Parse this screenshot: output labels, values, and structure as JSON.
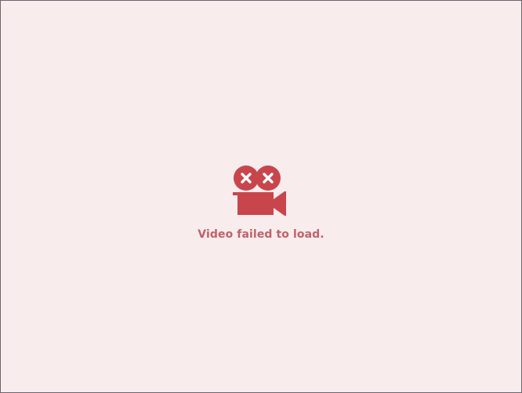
{
  "player": {
    "error_message": "Video failed to load.",
    "icon": "broken-video-camera-icon",
    "colors": {
      "background": "#f8eced",
      "icon": "#c9454c",
      "text": "#c0616a",
      "border": "#6e6470"
    }
  }
}
